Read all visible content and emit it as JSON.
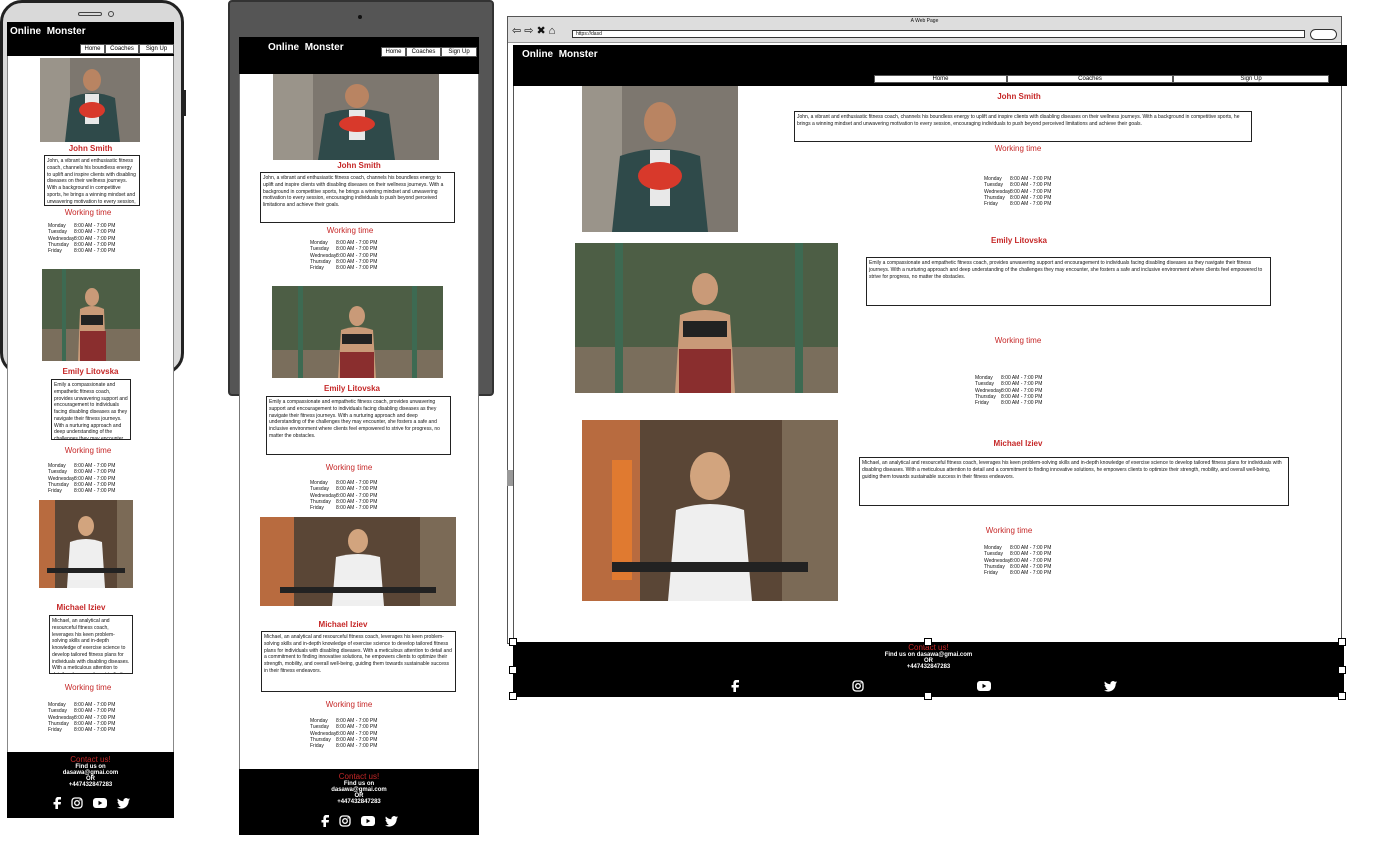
{
  "brand": {
    "line1": "Online",
    "line2": "Monster"
  },
  "nav": {
    "home": "Home",
    "coaches": "Coaches",
    "signup": "Sign Up"
  },
  "browser": {
    "title": "A Web Page",
    "url": "https://dasd"
  },
  "coaches": [
    {
      "name": "John Smith",
      "bio": "John, a vibrant and enthusiastic fitness coach, channels his boundless energy to uplift and inspire clients with disabling diseases on their wellness journeys. With a background in competitive sports, he brings a winning mindset and unwavering motivation to every session, encouraging individuals to push beyond perceived limitations and achieve their goals."
    },
    {
      "name": "Emily Litovska",
      "bio": "Emily a compassionate and empathetic fitness coach, provides unwavering support and encouragement to individuals facing disabling diseases as they navigate their fitness journeys. With a nurturing approach and deep understanding of the challenges they may encounter, she fosters a safe and inclusive environment where clients feel empowered to strive for progress, no matter the obstacles."
    },
    {
      "name": "Michael Iziev",
      "bio": "Michael, an analytical and resourceful fitness coach, leverages his keen problem-solving skills and in-depth knowledge of exercise science to develop tailored fitness plans for individuals with disabling diseases. With a meticulous attention to detail and a commitment to finding innovative solutions, he empowers clients to optimize their strength, mobility, and overall well-being, guiding them towards sustainable success in their fitness endeavors."
    }
  ],
  "working_time_label": "Working time",
  "hours": [
    {
      "day": "Monday",
      "time": "8:00 AM - 7:00 PM"
    },
    {
      "day": "Tuesday",
      "time": "8:00 AM - 7:00 PM"
    },
    {
      "day": "Wednesday",
      "time": "8:00 AM - 7:00 PM"
    },
    {
      "day": "Thursday",
      "time": "8:00 AM - 7:00 PM"
    },
    {
      "day": "Friday",
      "time": "8:00 AM - 7:00 PM"
    }
  ],
  "footer": {
    "contact": "Contact us!",
    "find": "Find us on",
    "email": "dasawa@gmai.com",
    "or": "OR",
    "phone": "+447432847283",
    "find_inline": "Find us on dasawa@gmai.com"
  },
  "icons": [
    "facebook-icon",
    "instagram-icon",
    "youtube-icon",
    "twitter-icon"
  ],
  "colors": {
    "accent": "#c62828",
    "nav": "#000000"
  }
}
